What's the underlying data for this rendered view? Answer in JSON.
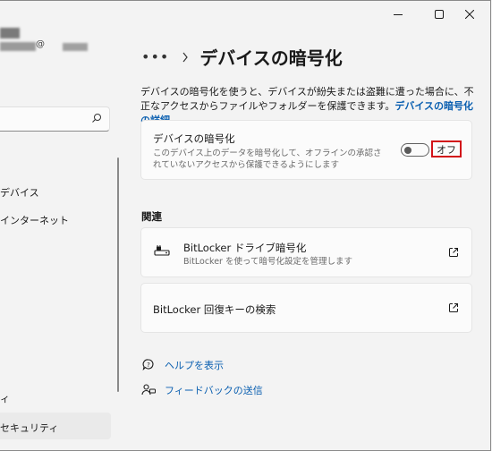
{
  "window": {
    "controls": [
      "minimize",
      "maximize",
      "close"
    ]
  },
  "account": {
    "email_domain": "@",
    "email_suffix": ""
  },
  "search": {
    "placeholder": ""
  },
  "sidebar": {
    "items": [
      {
        "label": "デバイス"
      },
      {
        "label": "インターネット"
      },
      {
        "label": "ィ"
      },
      {
        "label": "セキュリティ"
      }
    ]
  },
  "breadcrumb": {
    "more": "•••",
    "current": "デバイスの暗号化"
  },
  "description": {
    "text": "デバイスの暗号化を使うと、デバイスが紛失または盗難に遭った場合に、不正なアクセスからファイルやフォルダーを保護できます。",
    "link": "デバイスの暗号化の詳細"
  },
  "encryption_card": {
    "title": "デバイスの暗号化",
    "subtitle": "このデバイス上のデータを暗号化して、オフラインの承認されていないアクセスから保護できるようにします",
    "toggle_state": "オフ",
    "toggle_on": false
  },
  "related": {
    "heading": "関連",
    "items": [
      {
        "title": "BitLocker ドライブ暗号化",
        "subtitle": "BitLocker を使って暗号化設定を管理します",
        "icon": "bitlocker-icon"
      },
      {
        "title": "BitLocker 回復キーの検索",
        "subtitle": "",
        "icon": ""
      }
    ]
  },
  "links": {
    "help": "ヘルプを表示",
    "feedback": "フィードバックの送信"
  },
  "colors": {
    "accent": "#0a5fb0",
    "highlight": "#d21219",
    "background": "#f3f3f3"
  }
}
